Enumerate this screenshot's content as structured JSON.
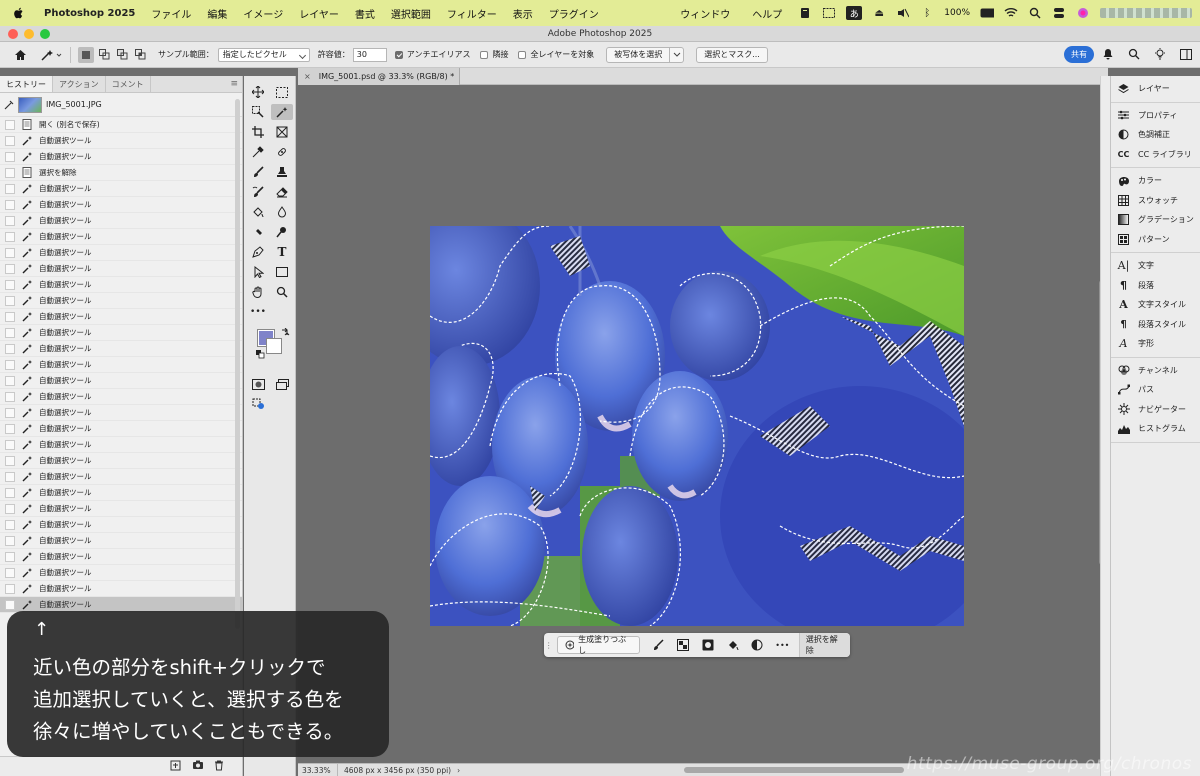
{
  "menubar": {
    "app_name": "Photoshop 2025",
    "items": [
      "ファイル",
      "編集",
      "イメージ",
      "レイヤー",
      "書式",
      "選択範囲",
      "フィルター",
      "表示",
      "プラグイン"
    ],
    "right_items": [
      "ウィンドウ",
      "ヘルプ"
    ],
    "ime": "あ",
    "battery": "100%"
  },
  "window": {
    "title": "Adobe Photoshop 2025"
  },
  "options": {
    "sample_label": "サンプル範囲：",
    "sample_value": "指定したピクセル",
    "tolerance_label": "許容値：",
    "tolerance_value": "30",
    "antialias": "アンチエイリアス",
    "contiguous": "隣接",
    "all_layers": "全レイヤーを対象",
    "select_subject": "被写体を選択",
    "select_mask": "選択とマスク...",
    "share": "共有"
  },
  "history": {
    "tabs": [
      "ヒストリー",
      "アクション",
      "コメント"
    ],
    "snapshot": "IMG_5001.JPG",
    "rows": [
      {
        "label": "開く (別名で保存)",
        "icon": "doc"
      },
      {
        "label": "自動選択ツール",
        "icon": "wand"
      },
      {
        "label": "自動選択ツール",
        "icon": "wand"
      },
      {
        "label": "選択を解除",
        "icon": "doc"
      },
      {
        "label": "自動選択ツール",
        "icon": "wand"
      },
      {
        "label": "自動選択ツール",
        "icon": "wand"
      },
      {
        "label": "自動選択ツール",
        "icon": "wand"
      },
      {
        "label": "自動選択ツール",
        "icon": "wand"
      },
      {
        "label": "自動選択ツール",
        "icon": "wand"
      },
      {
        "label": "自動選択ツール",
        "icon": "wand"
      },
      {
        "label": "自動選択ツール",
        "icon": "wand"
      },
      {
        "label": "自動選択ツール",
        "icon": "wand"
      },
      {
        "label": "自動選択ツール",
        "icon": "wand"
      },
      {
        "label": "自動選択ツール",
        "icon": "wand"
      },
      {
        "label": "自動選択ツール",
        "icon": "wand"
      },
      {
        "label": "自動選択ツール",
        "icon": "wand"
      },
      {
        "label": "自動選択ツール",
        "icon": "wand"
      },
      {
        "label": "自動選択ツール",
        "icon": "wand"
      },
      {
        "label": "自動選択ツール",
        "icon": "wand"
      },
      {
        "label": "自動選択ツール",
        "icon": "wand"
      },
      {
        "label": "自動選択ツール",
        "icon": "wand"
      },
      {
        "label": "自動選択ツール",
        "icon": "wand"
      },
      {
        "label": "自動選択ツール",
        "icon": "wand"
      },
      {
        "label": "自動選択ツール",
        "icon": "wand"
      },
      {
        "label": "自動選択ツール",
        "icon": "wand"
      },
      {
        "label": "自動選択ツール",
        "icon": "wand"
      },
      {
        "label": "自動選択ツール",
        "icon": "wand"
      },
      {
        "label": "自動選択ツール",
        "icon": "wand"
      },
      {
        "label": "自動選択ツール",
        "icon": "wand"
      },
      {
        "label": "自動選択ツール",
        "icon": "wand"
      },
      {
        "label": "自動選択ツール",
        "icon": "wand"
      }
    ]
  },
  "colors": {
    "foreground": "#7f83c9",
    "background": "#ffffff",
    "menubar": "#e3ec96",
    "accent": "#2b6fd6"
  },
  "document": {
    "tab_title": "IMG_5001.psd @ 33.3% (RGB/8) *",
    "zoom": "33.33%",
    "info": "4608 px x 3456 px (350 ppi)"
  },
  "contextbar": {
    "generative_fill": "生成塗りつぶし",
    "deselect": "選択を解除"
  },
  "panels": {
    "groups": [
      [
        {
          "label": "レイヤー",
          "icon": "layers-icon"
        }
      ],
      [
        {
          "label": "プロパティ",
          "icon": "properties-icon"
        },
        {
          "label": "色調補正",
          "icon": "adjustments-icon"
        },
        {
          "label": "CC ライブラリ",
          "icon": "libraries-icon"
        }
      ],
      [
        {
          "label": "カラー",
          "icon": "color-icon"
        },
        {
          "label": "スウォッチ",
          "icon": "swatches-icon"
        },
        {
          "label": "グラデーション",
          "icon": "gradient-icon"
        },
        {
          "label": "パターン",
          "icon": "pattern-icon"
        }
      ],
      [
        {
          "label": "文字",
          "icon": "character-icon"
        },
        {
          "label": "段落",
          "icon": "paragraph-icon"
        },
        {
          "label": "文字スタイル",
          "icon": "char-style-icon"
        },
        {
          "label": "段落スタイル",
          "icon": "para-style-icon"
        },
        {
          "label": "字形",
          "icon": "glyphs-icon"
        }
      ],
      [
        {
          "label": "チャンネル",
          "icon": "channels-icon"
        },
        {
          "label": "パス",
          "icon": "paths-icon"
        },
        {
          "label": "ナビゲーター",
          "icon": "navigator-icon"
        },
        {
          "label": "ヒストグラム",
          "icon": "histogram-icon"
        }
      ]
    ]
  },
  "caption": {
    "arrow": "↑",
    "line1": "近い色の部分をshift+クリックで",
    "line2": "追加選択していくと、選択する色を",
    "line3": "徐々に増やしていくこともできる。"
  },
  "watermark": "https://muse-group.org/chronos"
}
